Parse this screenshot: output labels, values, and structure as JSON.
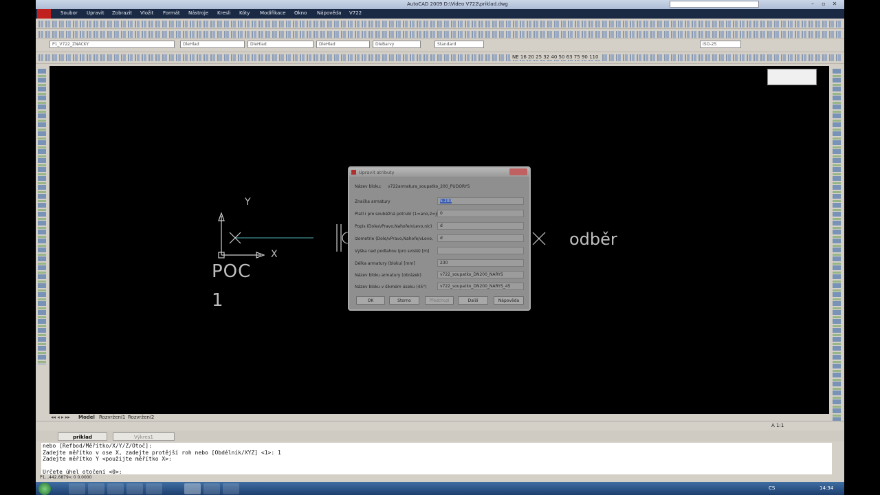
{
  "window": {
    "title": "AutoCAD 2009 D:\\Video V722\\priklad.dwg"
  },
  "menu": [
    "Soubor",
    "Upravit",
    "Zobrazit",
    "Vložit",
    "Formát",
    "Nástroje",
    "Kresli",
    "Kóty",
    "Modifikace",
    "Okno",
    "Nápověda",
    "V722"
  ],
  "toolbar": {
    "layer": "P1_V722_ZNACKY",
    "color": "DleHlad",
    "linetype": "DleHlad",
    "lineweight": "DleHlad",
    "plotstyle": "DleBarvy",
    "textstyle": "Standard",
    "dimstyle": "ISO-25",
    "dn_sizes": "NE 16 20 25 32 40 50 63 75 90 110"
  },
  "drawing": {
    "axis_y": "Y",
    "axis_x": "X",
    "label_poc": "POC",
    "label_num": "1",
    "label_odber": "odběr"
  },
  "layout_tabs": [
    "Model",
    "Rozvržení1",
    "Rozvržení2"
  ],
  "doc_tabs": [
    "priklad",
    "Výkres1"
  ],
  "command_lines": [
    "nebo [Refbod/Měřítko/X/Y/Z/Otoč]:",
    "Zadejte měřítko v ose X, zadejte protější roh nebo [Obdélník/XYZ] <1>: 1",
    "Zadejte měřítko Y <použijte měřítko X>:",
    "",
    "Určete úhel otočení <0>:"
  ],
  "coords": "P1...442.6879< 0   0.0000",
  "scale_label": "A 1:1",
  "tray": {
    "lang": "CS",
    "time": "14:34"
  },
  "dialog": {
    "title": "Upravit atributy",
    "block_label": "Název bloku:",
    "block_name": "v722armatura_soupatko_200_PUDORYS",
    "rows": [
      {
        "label": "Značka armatury",
        "value": "S-200"
      },
      {
        "label": "Platí i pro souběžná potrubí (1=ano,2=ji",
        "value": "0"
      },
      {
        "label": "Popis (Dole/vPravo,Nahoře/vLevo,nic)",
        "value": "d"
      },
      {
        "label": "Izometrie (Dole/vPravo,Nahoře/vLevo,",
        "value": "d"
      },
      {
        "label": "Výška nad podlahou (pro svislé) [m]",
        "value": ""
      },
      {
        "label": "Délka armatury (bloku) [mm]",
        "value": "230"
      },
      {
        "label": "Název bloku armatury (obrázek)",
        "value": "v722_soupatko_DN200_NARYS"
      },
      {
        "label": "Název bloku v šikmém úseku (45°)",
        "value": "v722_soupatko_DN200_NARYS_45"
      }
    ],
    "buttons": {
      "ok": "OK",
      "cancel": "Storno",
      "prev": "Předchozí",
      "next": "Další",
      "help": "Nápověda"
    }
  }
}
